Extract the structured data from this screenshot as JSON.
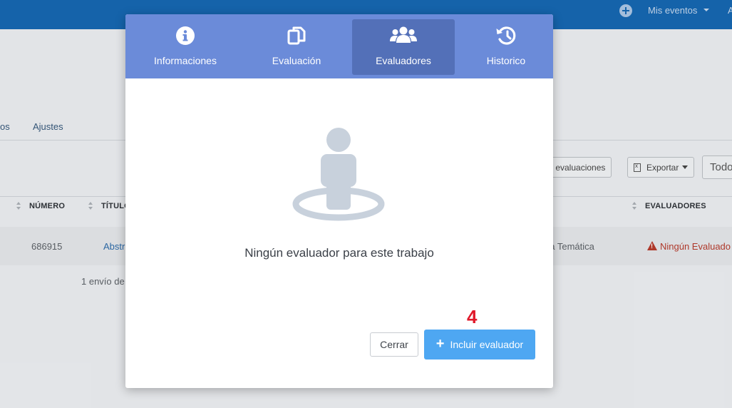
{
  "topbar": {
    "events_label": "Mis eventos",
    "edge_letter": "A"
  },
  "background": {
    "tabs": [
      "os",
      "Ajustes"
    ],
    "buttons": {
      "evaluations": "tar evaluaciones",
      "export": "Exportar",
      "select": "Todo"
    },
    "table": {
      "headers": [
        "NÚMERO",
        "TÍTULO",
        "EVALUADORES"
      ],
      "row": {
        "number": "686915",
        "title": "Abstr",
        "theme": "ea Temática",
        "evaluators": "Ningún Evaluado"
      },
      "count": "1 envío de"
    }
  },
  "modal": {
    "tabs": [
      {
        "label": "Informaciones",
        "icon": "info-circle-icon"
      },
      {
        "label": "Evaluación",
        "icon": "copy-documents-icon"
      },
      {
        "label": "Evaluadores",
        "icon": "users-group-icon",
        "active": true
      },
      {
        "label": "Historico",
        "icon": "history-icon"
      }
    ],
    "empty_message": "Ningún evaluador para este trabajo",
    "annotation": "4",
    "buttons": {
      "close": "Cerrar",
      "add": "Incluir evaluador"
    }
  },
  "colors": {
    "topbar": "#1667b0",
    "tabs_bg": "#6b8bd9",
    "tab_active": "#5370b8",
    "primary_button": "#4ea7f2",
    "annotation": "#e0192a",
    "warning": "#b43a2c"
  }
}
